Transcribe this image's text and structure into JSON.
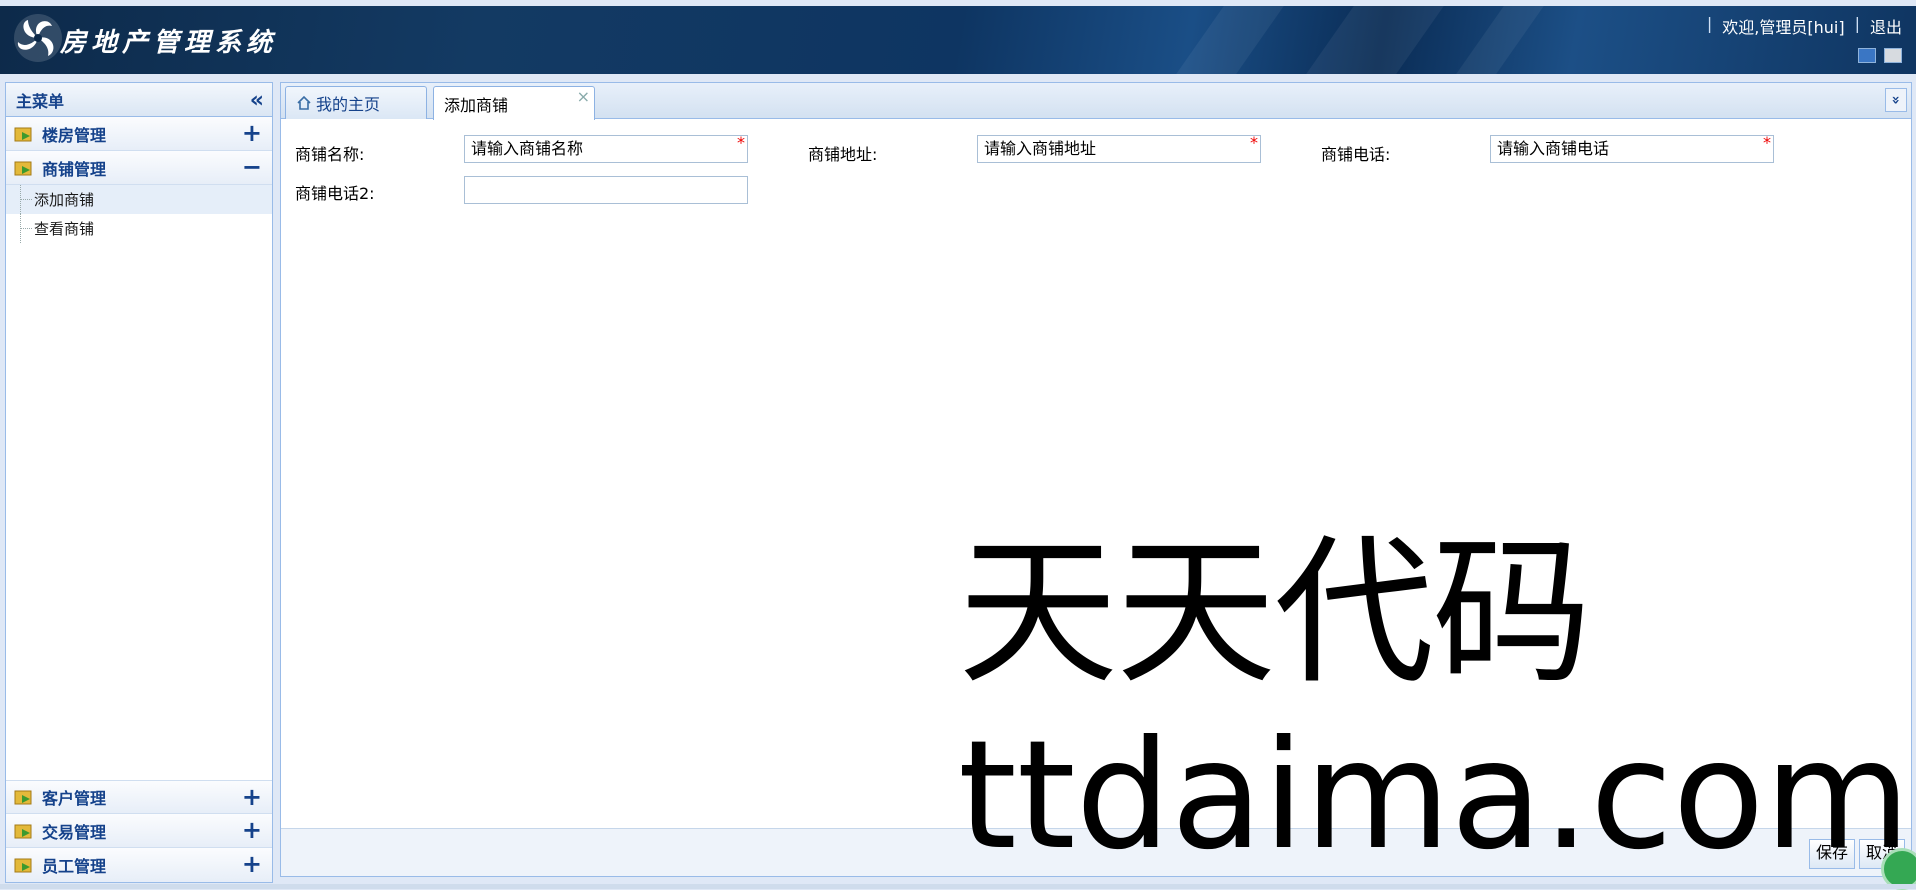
{
  "header": {
    "app_title": "房地产管理系统",
    "separator": "|",
    "welcome": "欢迎,管理员[hui]",
    "logout": "退出"
  },
  "sidebar": {
    "title": "主菜单",
    "collapse_icon": "«",
    "groups": [
      {
        "label": "楼房管理",
        "toggle": "+"
      },
      {
        "label": "商铺管理",
        "toggle": "−",
        "items": [
          {
            "label": "添加商铺"
          },
          {
            "label": "查看商铺"
          }
        ]
      },
      {
        "label": "客户管理",
        "toggle": "+"
      },
      {
        "label": "交易管理",
        "toggle": "+"
      },
      {
        "label": "员工管理",
        "toggle": "+"
      }
    ]
  },
  "tabs": [
    {
      "label": "我的主页",
      "icon": "home-icon"
    },
    {
      "label": "添加商铺",
      "close": "×"
    }
  ],
  "tab_menu_icon": "»",
  "form": {
    "fields": [
      {
        "label": "商铺名称:",
        "placeholder": "请输入商铺名称",
        "required": "*"
      },
      {
        "label": "商铺地址:",
        "placeholder": "请输入商铺地址",
        "required": "*"
      },
      {
        "label": "商铺电话:",
        "placeholder": "请输入商铺电话",
        "required": "*"
      },
      {
        "label": "商铺电话2:",
        "placeholder": "",
        "required": ""
      }
    ]
  },
  "buttons": {
    "save": "保存",
    "cancel": "取消"
  },
  "watermark": {
    "line1": "天天代码",
    "line2": "ttdaima.com"
  },
  "colors": {
    "header_dark": "#0d2a4a",
    "panel_border": "#99bbe8",
    "menu_text": "#15428b",
    "required": "#ee0000"
  }
}
